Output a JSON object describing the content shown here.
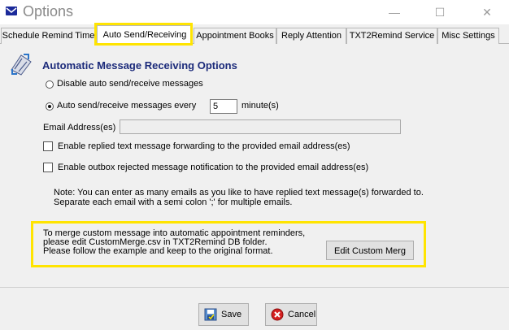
{
  "window": {
    "title": "Options",
    "minimize_glyph": "—",
    "maximize_glyph": "☐",
    "close_glyph": "✕"
  },
  "tabs": [
    {
      "label": "Schedule Remind Time",
      "active": false
    },
    {
      "label": "Auto Send/Receiving",
      "active": true
    },
    {
      "label": "Appointment Books",
      "active": false
    },
    {
      "label": "Reply Attention",
      "active": false
    },
    {
      "label": "TXT2Remind Service",
      "active": false
    },
    {
      "label": "Misc Settings",
      "active": false
    }
  ],
  "panel": {
    "heading": "Automatic Message Receiving Options",
    "disable_option": {
      "label": "Disable auto send/receive messages",
      "checked": false
    },
    "auto_option": {
      "label": "Auto send/receive messages every",
      "checked": true
    },
    "interval_value": "5",
    "interval_unit": "minute(s)",
    "email_label": "Email Address(es)",
    "email_value": "",
    "forward_check": {
      "label": "Enable replied text message forwarding to the provided email address(es)",
      "checked": false
    },
    "reject_check": {
      "label": "Enable outbox rejected message notification to the provided email address(es)",
      "checked": false
    },
    "note_line1": "Note: You can enter as many emails as you like to have replied text message(s) forwarded to.",
    "note_line2": "Separate each email with a semi colon ';' for multiple emails.",
    "merge_line1": "To merge custom message into automatic appointment reminders,",
    "merge_line2": "please edit CustomMerge.csv in TXT2Remind DB folder.",
    "merge_line3": "Please follow the example and keep to the original format.",
    "edit_button": "Edit Custom Merg"
  },
  "footer": {
    "save_label": "Save",
    "cancel_label": "Cancel"
  },
  "colors": {
    "highlight": "#ffe400",
    "heading": "#1b2a7a",
    "cancel_icon": "#d42020"
  },
  "icons": [
    "app-envelope-icon",
    "receive-send-icon",
    "save-icon",
    "cancel-icon"
  ]
}
